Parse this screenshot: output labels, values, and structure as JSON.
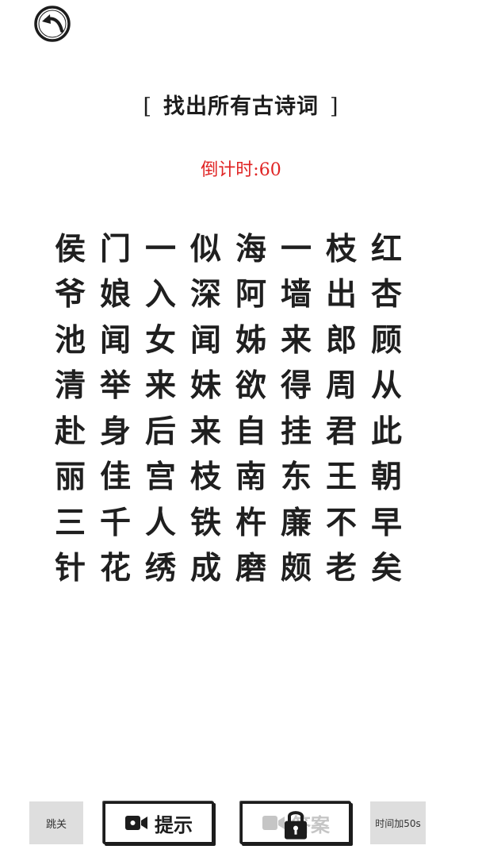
{
  "header": {
    "title": "找出所有古诗词",
    "bracket_left": "[",
    "bracket_right": "]",
    "countdown": "倒计时:60"
  },
  "grid": {
    "rows": [
      [
        "侯",
        "门",
        "一",
        "似",
        "海",
        "一",
        "枝",
        "红"
      ],
      [
        "爷",
        "娘",
        "入",
        "深",
        "阿",
        "墙",
        "出",
        "杏"
      ],
      [
        "池",
        "闻",
        "女",
        "闻",
        "姊",
        "来",
        "郎",
        "顾"
      ],
      [
        "清",
        "举",
        "来",
        "妹",
        "欲",
        "得",
        "周",
        "从"
      ],
      [
        "赴",
        "身",
        "后",
        "来",
        "自",
        "挂",
        "君",
        "此"
      ],
      [
        "丽",
        "佳",
        "宫",
        "枝",
        "南",
        "东",
        "王",
        "朝"
      ],
      [
        "三",
        "千",
        "人",
        "铁",
        "杵",
        "廉",
        "不",
        "早"
      ],
      [
        "针",
        "花",
        "绣",
        "成",
        "磨",
        "颇",
        "老",
        "矣"
      ]
    ]
  },
  "bottom_bar": {
    "skip_label": "跳关",
    "hint_label": "提示",
    "answer_label": "答案",
    "add_time_label": "时间加50s"
  },
  "icons": {
    "back": "back-arrow-icon",
    "video": "video-camera-icon",
    "lock": "lock-icon"
  },
  "colors": {
    "countdown": "#e02424",
    "text": "#1f1f1f",
    "button_gray": "#dedede"
  }
}
